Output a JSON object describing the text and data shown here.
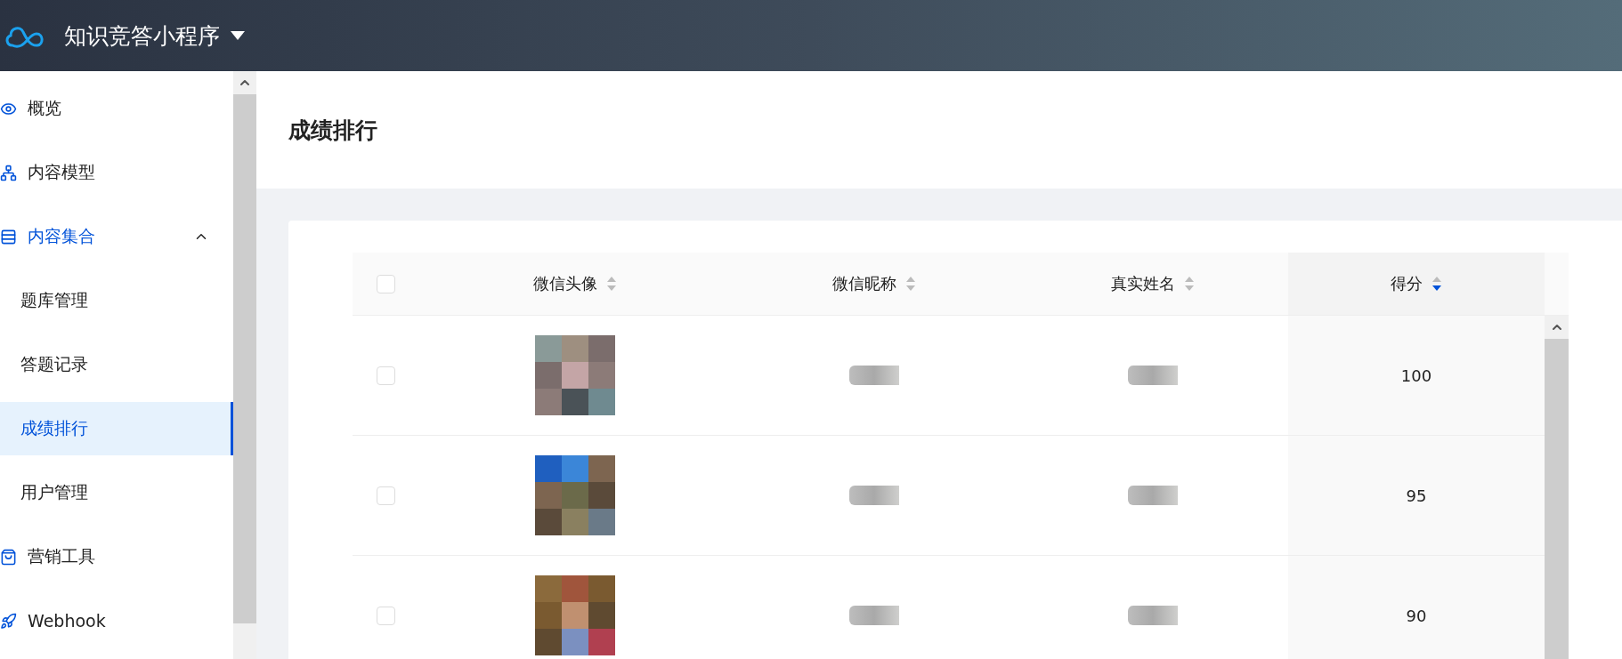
{
  "app": {
    "title": "知识竞答小程序"
  },
  "sidebar": {
    "items": [
      {
        "label": "概览",
        "selected": false
      },
      {
        "label": "内容模型",
        "selected": false
      },
      {
        "label": "内容集合",
        "selected": false,
        "expanded": true,
        "children": [
          {
            "label": "题库管理",
            "selected": false
          },
          {
            "label": "答题记录",
            "selected": false
          },
          {
            "label": "成绩排行",
            "selected": true
          },
          {
            "label": "用户管理",
            "selected": false
          }
        ]
      },
      {
        "label": "营销工具",
        "selected": false
      },
      {
        "label": "Webhook",
        "selected": false
      }
    ]
  },
  "page": {
    "title": "成绩排行"
  },
  "table": {
    "select_all": {
      "checked": false
    },
    "columns": [
      {
        "label": "微信头像",
        "sorted": false
      },
      {
        "label": "微信昵称",
        "sorted": false
      },
      {
        "label": "真实姓名",
        "sorted": false
      },
      {
        "label": "得分",
        "sorted": true,
        "descending": true
      }
    ],
    "rows": [
      {
        "checked": false,
        "score": "100"
      },
      {
        "checked": false,
        "score": "95"
      },
      {
        "checked": false,
        "score": "90"
      }
    ]
  }
}
